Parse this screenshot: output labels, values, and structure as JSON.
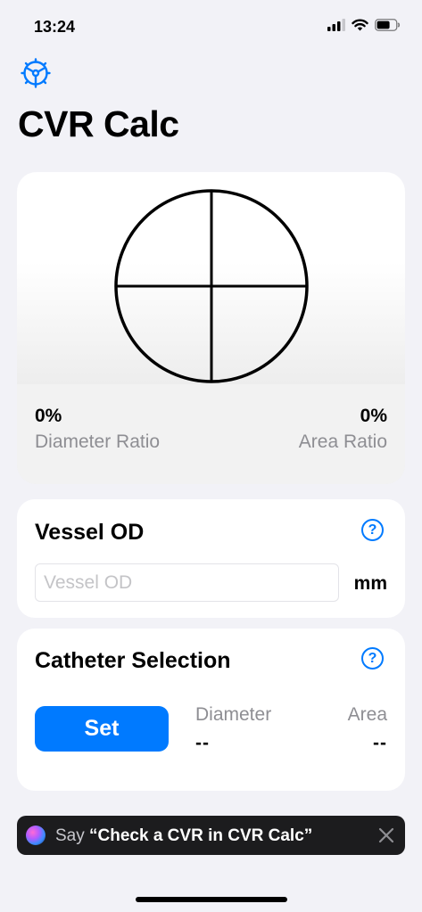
{
  "status_bar": {
    "time": "13:24"
  },
  "header": {
    "title": "CVR Calc"
  },
  "icons": {
    "settings": "gear-icon",
    "help": "question-circle-icon",
    "close": "close-icon",
    "siri": "siri-icon"
  },
  "visualization": {
    "diameter_ratio_value": "0%",
    "diameter_ratio_label": "Diameter Ratio",
    "area_ratio_value": "0%",
    "area_ratio_label": "Area Ratio"
  },
  "vessel_od": {
    "title": "Vessel OD",
    "help_glyph": "?",
    "input_placeholder": "Vessel OD",
    "input_value": "",
    "unit": "mm"
  },
  "catheter_selection": {
    "title": "Catheter Selection",
    "help_glyph": "?",
    "set_button_label": "Set",
    "diameter_label": "Diameter",
    "diameter_value": "--",
    "area_label": "Area",
    "area_value": "--"
  },
  "siri_suggestion": {
    "prefix": "Say ",
    "phrase": "“Check a CVR in CVR Calc”"
  },
  "colors": {
    "accent": "#007aff",
    "background": "#f2f2f7",
    "secondary_text": "#8e8e93",
    "siri_banner": "#1c1c1e"
  }
}
